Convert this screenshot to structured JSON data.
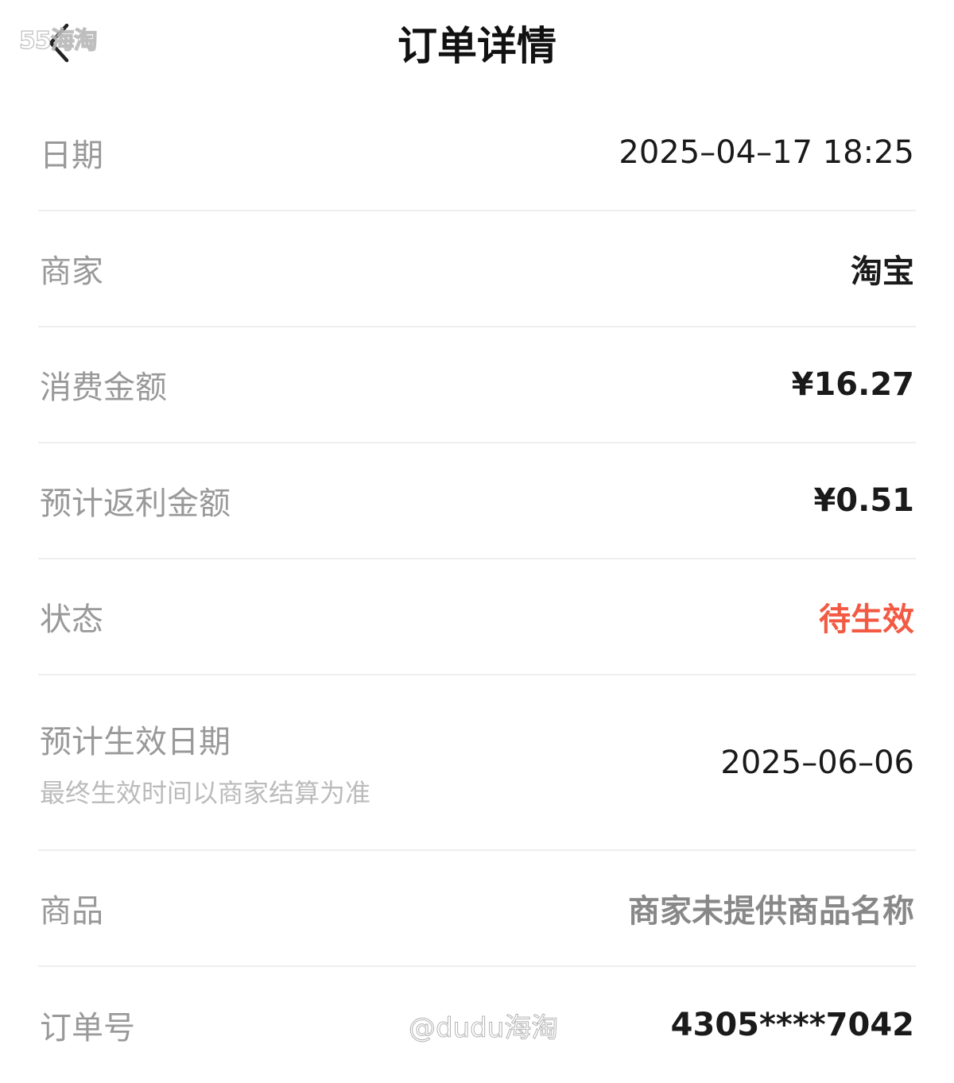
{
  "header": {
    "title": "订单详情",
    "watermark_logo": "55海淘"
  },
  "rows": {
    "date": {
      "label": "日期",
      "value": "2025–04–17 18:25"
    },
    "merchant": {
      "label": "商家",
      "value": "淘宝"
    },
    "amount": {
      "label": "消费金额",
      "value": "¥16.27"
    },
    "rebate": {
      "label": "预计返利金额",
      "value": "¥0.51"
    },
    "status": {
      "label": "状态",
      "value": "待生效"
    },
    "effective_date": {
      "label": "预计生效日期",
      "note": "最终生效时间以商家结算为准",
      "value": "2025–06–06"
    },
    "product": {
      "label": "商品",
      "value": "商家未提供商品名称"
    },
    "order_no": {
      "label": "订单号",
      "value": "4305****7042"
    }
  },
  "watermark_bottom": "@dudu海淘",
  "colors": {
    "status": "#f25a43",
    "label": "#999999",
    "value": "#1a1a1a",
    "divider": "#eeeeee"
  },
  "icons": {
    "back": "chevron-left-icon"
  }
}
